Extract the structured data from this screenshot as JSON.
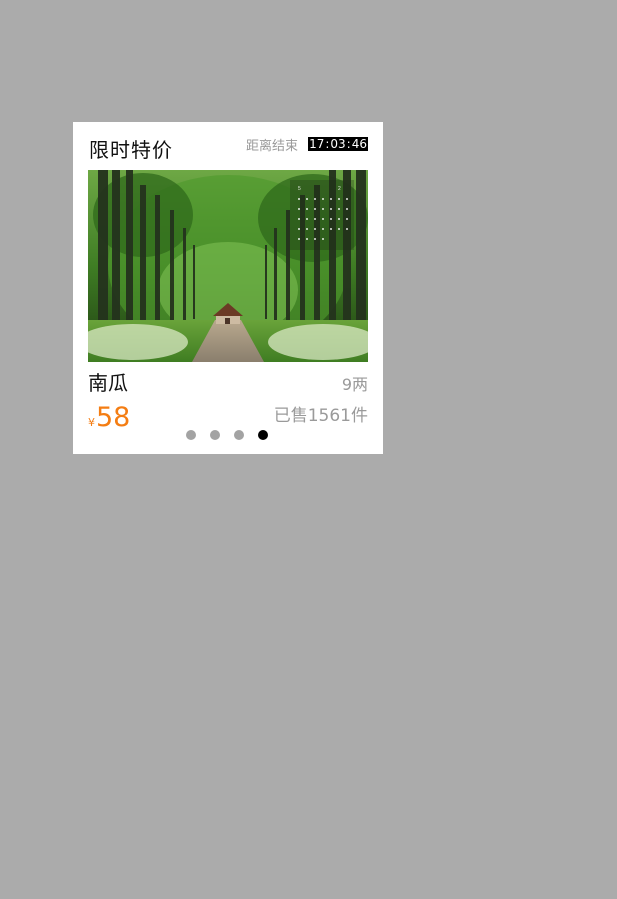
{
  "card": {
    "title": "限时特价",
    "countdown": {
      "label": "距离结束",
      "hours": "17",
      "minutes": "03",
      "seconds": "46",
      "separator": ":"
    },
    "image_icon": "tree-lined-path-photo",
    "product": {
      "name": "南瓜",
      "unit": "9两",
      "currency_symbol": "¥",
      "price": "58",
      "sold_text": "已售1561件"
    },
    "carousel": {
      "total": 4,
      "active_index": 3
    }
  },
  "colors": {
    "background": "#ababab",
    "price": "#f47d13",
    "muted_text": "#9a9a9a",
    "dot_inactive": "#a3a3a3",
    "dot_active": "#000000"
  }
}
